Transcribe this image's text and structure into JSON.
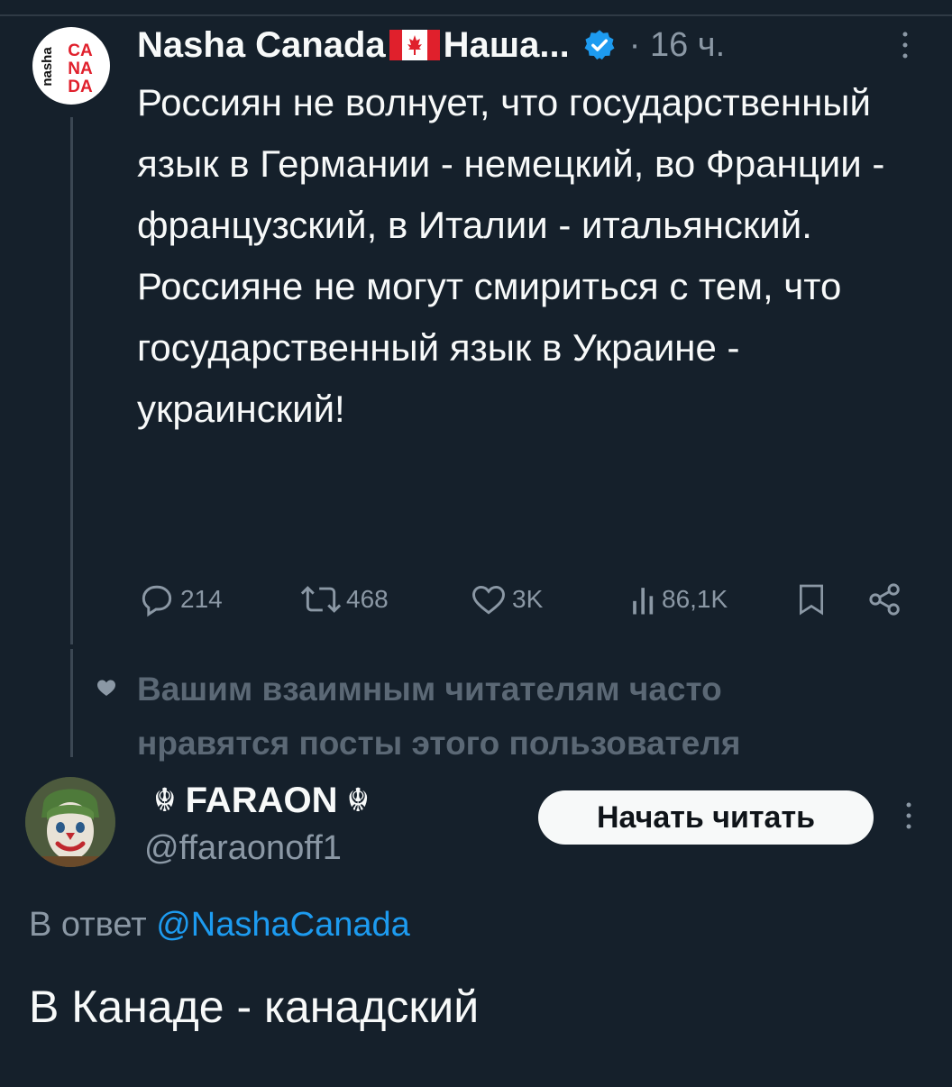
{
  "post": {
    "author_name": "Nasha Canada",
    "author_name_suffix": "Наша...",
    "time": "· 16 ч.",
    "avatar_text": {
      "side": "nasha",
      "grid": [
        "CA",
        "NA",
        "DA"
      ]
    },
    "text_paragraphs": [
      "Россиян не волнует, что государственный язык в Германии - немецкий, во Франции - французский, в Италии - итальянский.",
      "Россияне не могут смириться с тем, что государственный язык в Украине - украинский!"
    ],
    "actions": {
      "replies": "214",
      "reposts": "468",
      "likes": "3K",
      "views": "86,1K"
    }
  },
  "social_context": "Вашим взаимным читателям часто нравятся посты этого пользователя",
  "suggested_user": {
    "display_name": "FARAON",
    "emoji": "☬",
    "handle": "@ffaraonoff1",
    "follow_label": "Начать читать"
  },
  "reply": {
    "reply_prefix": "В ответ",
    "mention": "@NashaCanada",
    "text": "В Канаде - канадский"
  },
  "colors": {
    "background": "#15202b",
    "text": "#f7f9f9",
    "secondary": "#8b98a5",
    "accent": "#1d9bf0",
    "brand_red": "#e0202c"
  },
  "icons": [
    "reply-icon",
    "repost-icon",
    "like-icon",
    "views-icon",
    "bookmark-icon",
    "share-icon",
    "verified-icon",
    "more-icon",
    "canada-flag-icon",
    "heart-icon"
  ]
}
